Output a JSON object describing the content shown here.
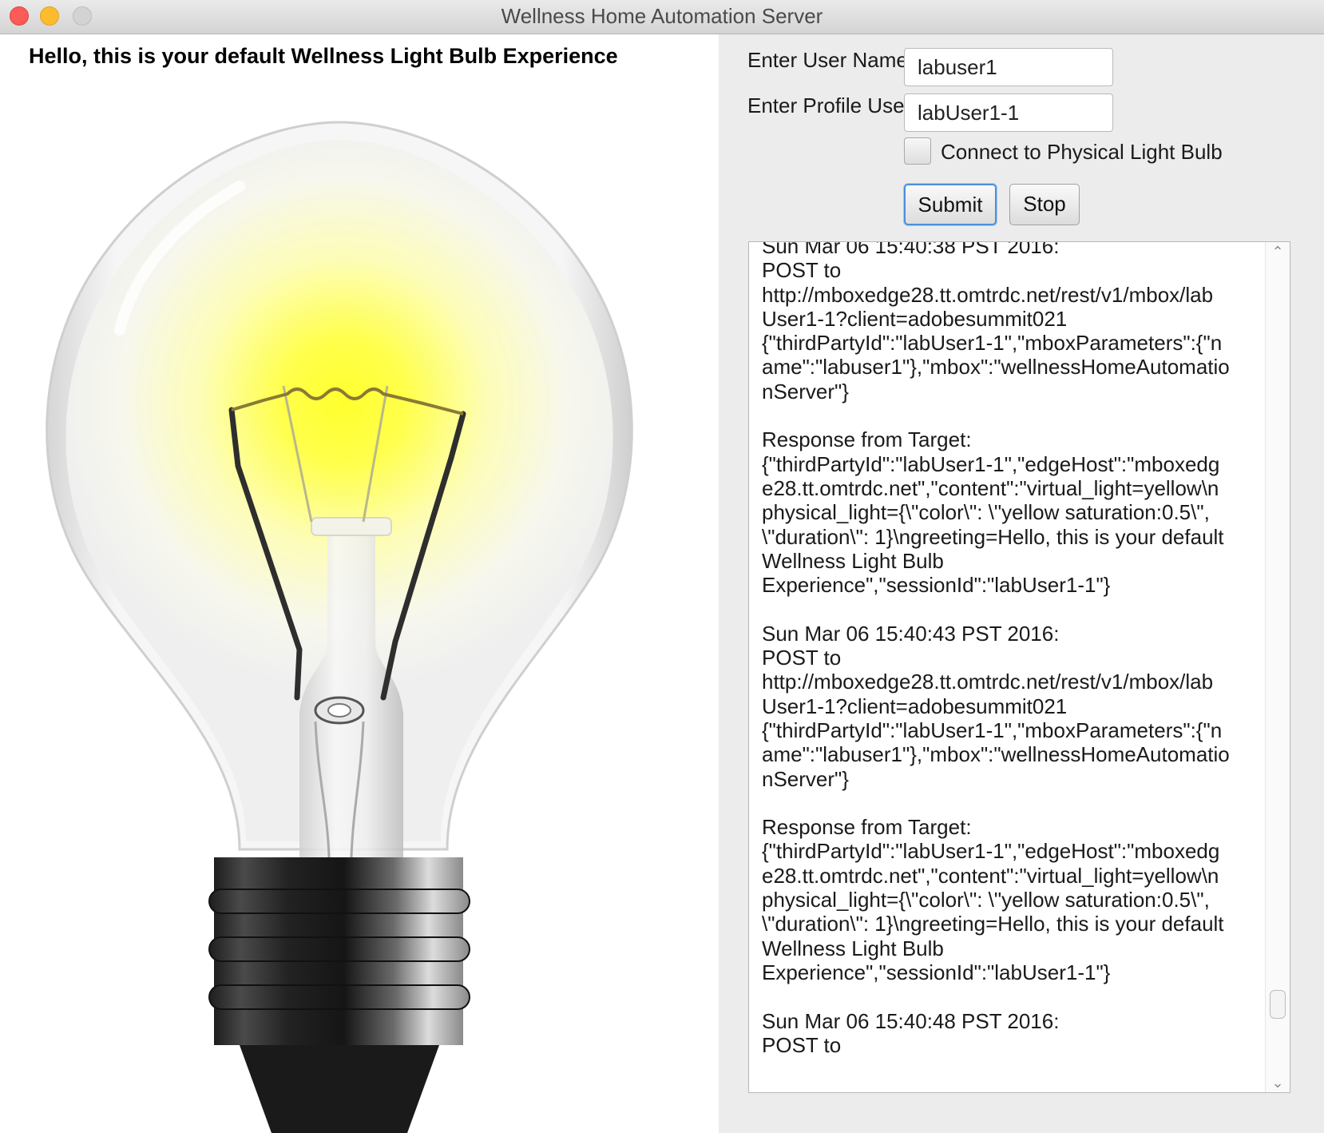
{
  "window": {
    "title": "Wellness Home Automation Server"
  },
  "main": {
    "greeting": "Hello, this is your default Wellness Light Bulb Experience",
    "light_color": "#ffff33"
  },
  "form": {
    "user_name_label": "Enter User Name",
    "user_name_value": "labuser1",
    "profile_userid_label": "Enter Profile UserId",
    "profile_userid_value": "labUser1-1",
    "connect_label": "Connect to Physical Light Bulb",
    "connect_checked": false,
    "submit_label": "Submit",
    "stop_label": "Stop"
  },
  "log": {
    "text": "Sun Mar 06 15:40:38 PST 2016:\nPOST to\nhttp://mboxedge28.tt.omtrdc.net/rest/v1/mbox/lab\nUser1-1?client=adobesummit021\n{\"thirdPartyId\":\"labUser1-1\",\"mboxParameters\":{\"n\name\":\"labuser1\"},\"mbox\":\"wellnessHomeAutomatio\nnServer\"}\n\nResponse from Target:\n{\"thirdPartyId\":\"labUser1-1\",\"edgeHost\":\"mboxedg\ne28.tt.omtrdc.net\",\"content\":\"virtual_light=yellow\\n\nphysical_light={\\\"color\\\": \\\"yellow saturation:0.5\\\",\n\\\"duration\\\": 1}\\ngreeting=Hello, this is your default\nWellness Light Bulb\nExperience\",\"sessionId\":\"labUser1-1\"}\n\nSun Mar 06 15:40:43 PST 2016:\nPOST to\nhttp://mboxedge28.tt.omtrdc.net/rest/v1/mbox/lab\nUser1-1?client=adobesummit021\n{\"thirdPartyId\":\"labUser1-1\",\"mboxParameters\":{\"n\name\":\"labuser1\"},\"mbox\":\"wellnessHomeAutomatio\nnServer\"}\n\nResponse from Target:\n{\"thirdPartyId\":\"labUser1-1\",\"edgeHost\":\"mboxedg\ne28.tt.omtrdc.net\",\"content\":\"virtual_light=yellow\\n\nphysical_light={\\\"color\\\": \\\"yellow saturation:0.5\\\",\n\\\"duration\\\": 1}\\ngreeting=Hello, this is your default\nWellness Light Bulb\nExperience\",\"sessionId\":\"labUser1-1\"}\n\nSun Mar 06 15:40:48 PST 2016:\nPOST to"
  }
}
